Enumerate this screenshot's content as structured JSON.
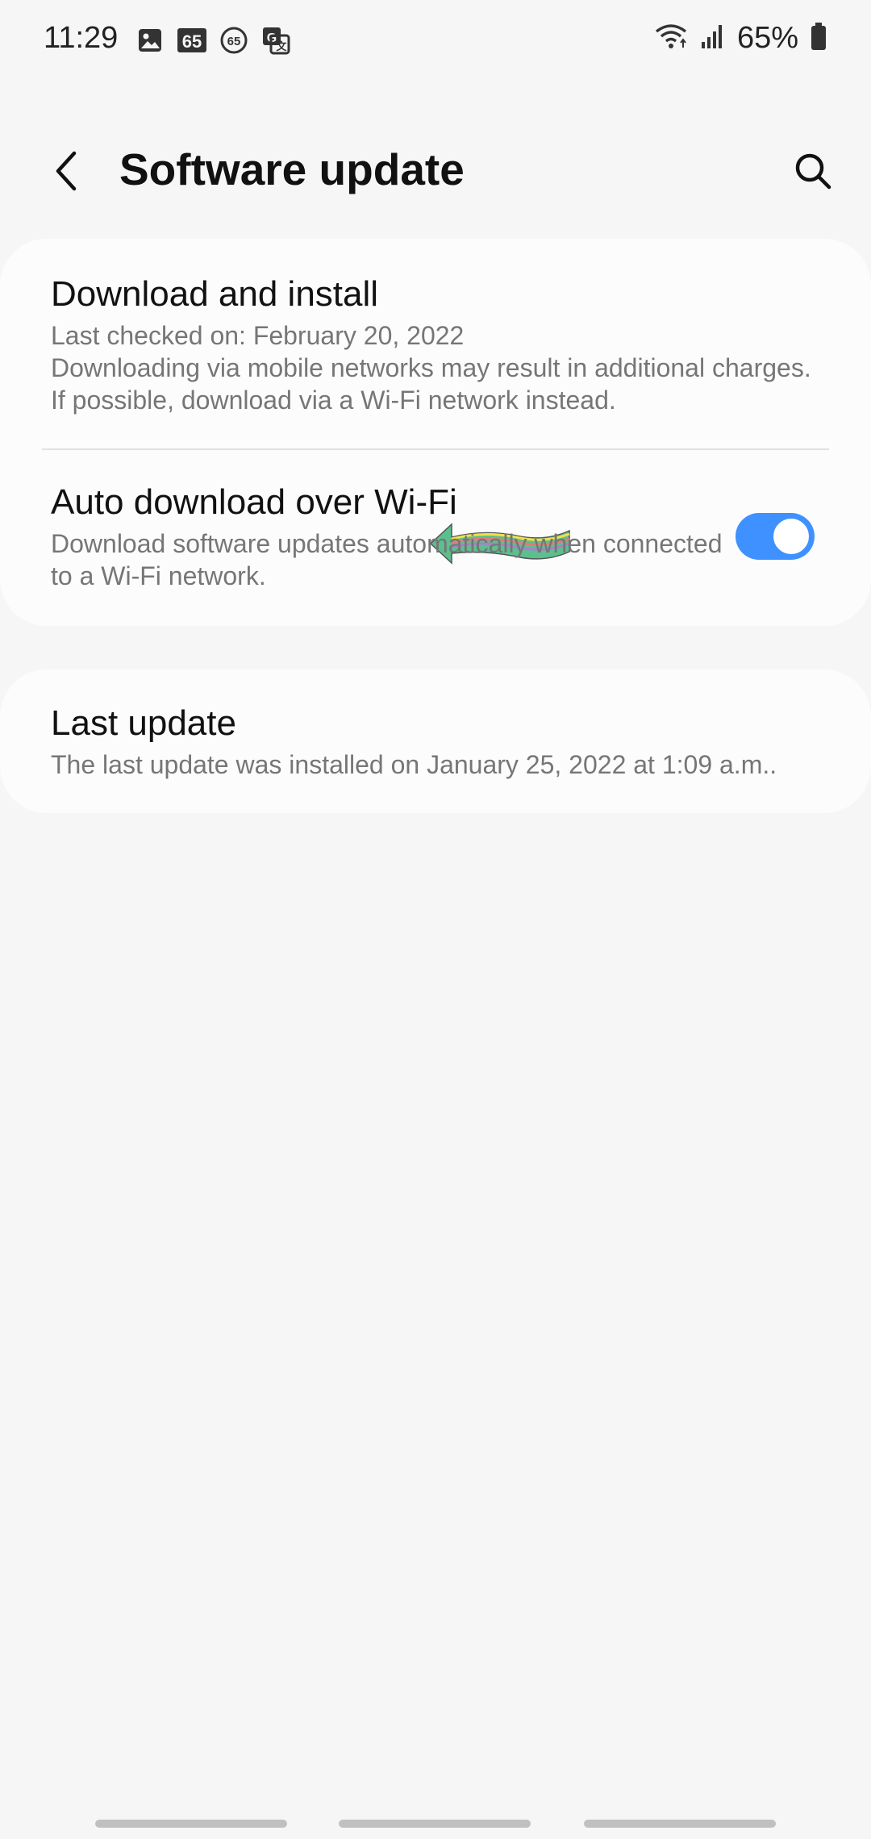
{
  "status_bar": {
    "time": "11:29",
    "battery": "65%",
    "left_icons": [
      "gallery-icon",
      "badge-65-icon",
      "circle-65-icon",
      "translate-icon"
    ],
    "right_icons": [
      "wifi-icon",
      "signal-icon",
      "battery-icon"
    ]
  },
  "header": {
    "title": "Software update"
  },
  "download_section": {
    "title": "Download and install",
    "last_checked": "Last checked on: February 20, 2022",
    "note": "Downloading via mobile networks may result in additional charges. If possible, download via a Wi-Fi network instead."
  },
  "auto_download": {
    "title": "Auto download over Wi-Fi",
    "description": "Download software updates automatically when connected to a Wi-Fi network.",
    "enabled": true
  },
  "last_update": {
    "title": "Last update",
    "description": "The last update was installed on January 25, 2022 at 1:09 a.m.."
  },
  "colors": {
    "accent": "#3e91ff",
    "background": "#f6f6f6",
    "card": "#fcfcfc"
  }
}
